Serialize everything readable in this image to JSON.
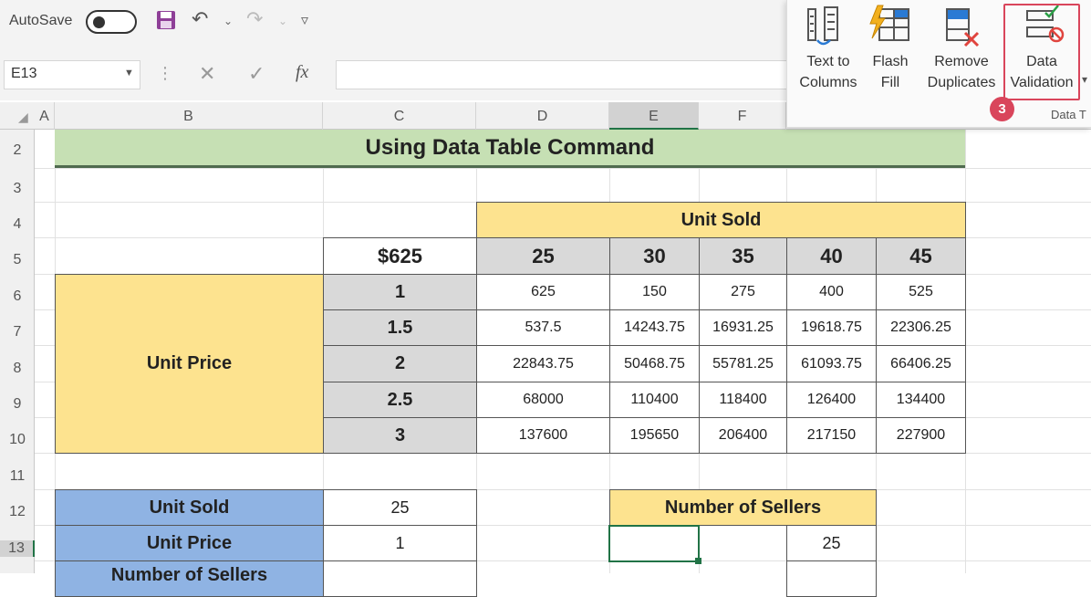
{
  "quick_access": {
    "autosave_label": "AutoSave"
  },
  "formula_bar": {
    "name_box": "E13",
    "fx_label": "fx"
  },
  "ribbon": {
    "buttons": [
      {
        "line1": "Text to",
        "line2": "Columns"
      },
      {
        "line1": "Flash",
        "line2": "Fill"
      },
      {
        "line1": "Remove",
        "line2": "Duplicates"
      },
      {
        "line1": "Data",
        "line2": "Validation"
      }
    ],
    "step_badge": "3",
    "group_label": "Data T"
  },
  "columns": [
    "A",
    "B",
    "C",
    "D",
    "E",
    "F"
  ],
  "rows": [
    "2",
    "3",
    "4",
    "5",
    "6",
    "7",
    "8",
    "9",
    "10",
    "11",
    "12",
    "13"
  ],
  "sheet": {
    "title": "Using Data Table Command",
    "unit_sold_header": "Unit Sold",
    "corner_value": "$625",
    "unit_sold_values": [
      "25",
      "30",
      "35",
      "40",
      "45"
    ],
    "unit_price_label": "Unit Price",
    "unit_price_values": [
      "1",
      "1.5",
      "2",
      "2.5",
      "3"
    ],
    "table": [
      [
        "625",
        "150",
        "275",
        "400",
        "525"
      ],
      [
        "537.5",
        "14243.75",
        "16931.25",
        "19618.75",
        "22306.25"
      ],
      [
        "22843.75",
        "50468.75",
        "55781.25",
        "61093.75",
        "66406.25"
      ],
      [
        "68000",
        "110400",
        "118400",
        "126400",
        "134400"
      ],
      [
        "137600",
        "195650",
        "206400",
        "217150",
        "227900"
      ]
    ],
    "inputs": [
      {
        "label": "Unit Sold",
        "value": "25"
      },
      {
        "label": "Unit Price",
        "value": "1"
      },
      {
        "label": "Number of Sellers",
        "value": ""
      }
    ],
    "sellers_header": "Number of Sellers",
    "sellers_value": "25"
  },
  "colors": {
    "yellow": "#fde38f",
    "grey": "#d9d9d9",
    "blue": "#8fb3e3",
    "green": "#c6e0b4",
    "badge": "#d9455b"
  }
}
